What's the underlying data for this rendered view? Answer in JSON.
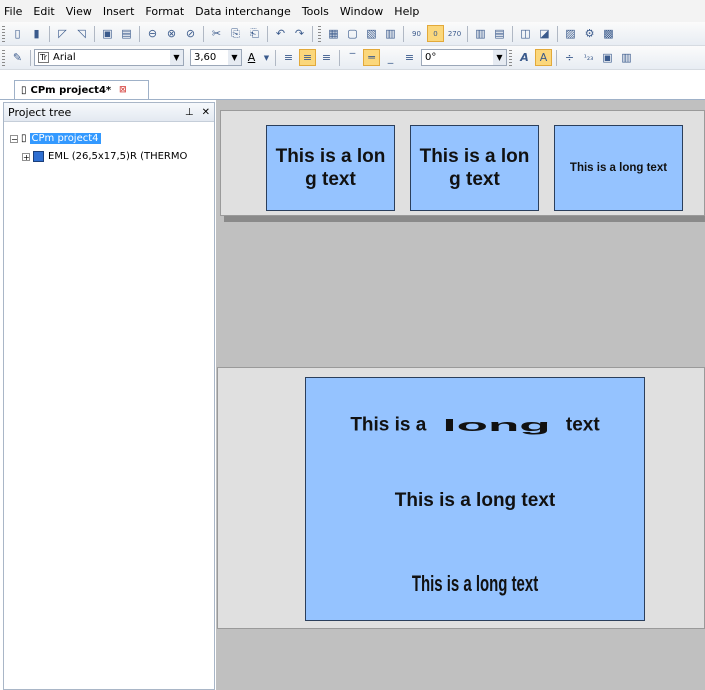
{
  "menu": [
    "File",
    "Edit",
    "View",
    "Insert",
    "Format",
    "Data interchange",
    "Tools",
    "Window",
    "Help"
  ],
  "toolbar": {
    "font_name": "Arial",
    "font_size": "3,60",
    "rotation": "0°",
    "rot90_label": "90",
    "rot0_label": "0",
    "rot270_label": "270"
  },
  "tab": {
    "label": "CPm project4*"
  },
  "panel": {
    "title": "Project tree",
    "pin": "⊥",
    "close": "✕"
  },
  "tree": {
    "root": "CPm project4",
    "child": "EML (26,5x17,5)R (THERMO"
  },
  "labels": {
    "box1": "This is a long text",
    "box2": "This is a long text",
    "box3": "This is a long text",
    "big_line1_a": "This is a",
    "big_line1_b": "long",
    "big_line1_c": "text",
    "big_line2": "This is a long text",
    "big_line3": "This is a long text"
  },
  "colors": {
    "label_fill": "#95c3ff",
    "canvas_bg": "#c0c0c0",
    "selection": "#3399ff"
  }
}
